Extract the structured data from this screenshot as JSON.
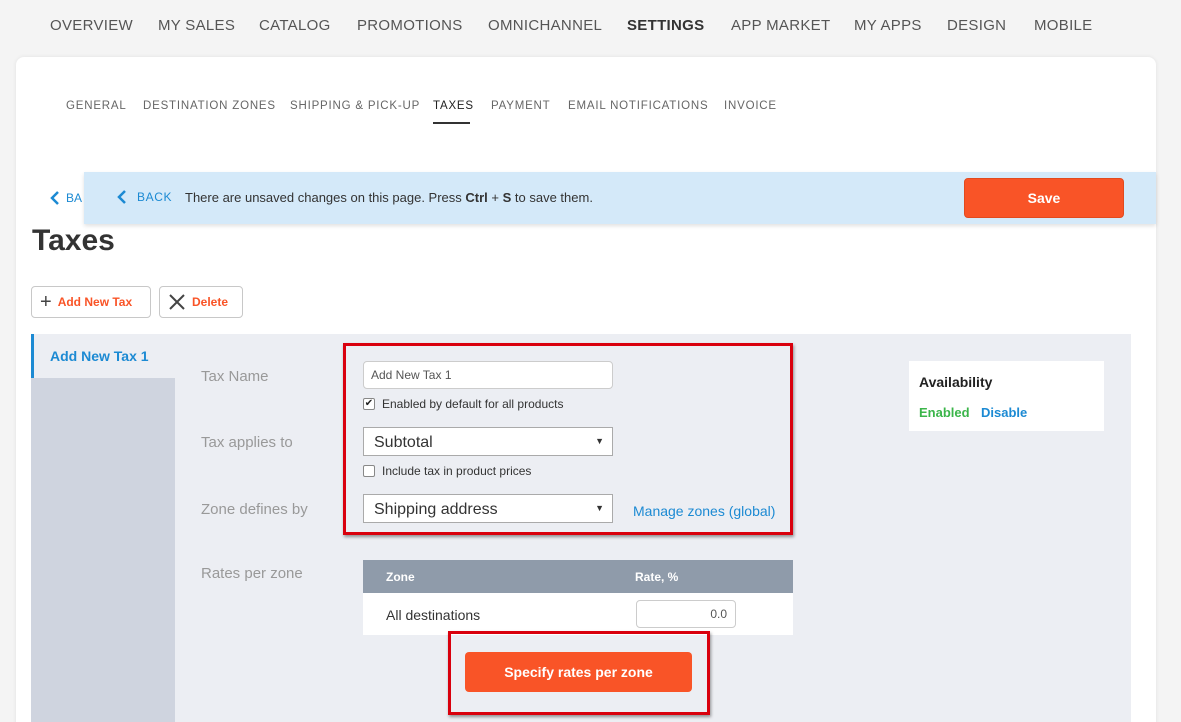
{
  "topnav": {
    "items": [
      "OVERVIEW",
      "MY SALES",
      "CATALOG",
      "PROMOTIONS",
      "OMNICHANNEL",
      "SETTINGS",
      "APP MARKET",
      "MY APPS",
      "DESIGN",
      "MOBILE"
    ],
    "active": "SETTINGS"
  },
  "subtabs": {
    "items": [
      "GENERAL",
      "DESTINATION ZONES",
      "SHIPPING & PICK-UP",
      "TAXES",
      "PAYMENT",
      "EMAIL NOTIFICATIONS",
      "INVOICE"
    ],
    "active": "TAXES"
  },
  "back_under_label": "BA",
  "unsaved_bar": {
    "back_label": "BACK",
    "message_prefix": "There are unsaved changes on this page. Press ",
    "key1": "Ctrl",
    "plus": " + ",
    "key2": "S",
    "message_suffix": " to save them.",
    "save_label": "Save"
  },
  "page_title": "Taxes",
  "actions": {
    "add_label": "Add New Tax",
    "delete_label": "Delete"
  },
  "sidebar": {
    "items": [
      "Add New Tax 1"
    ]
  },
  "form": {
    "tax_name_label": "Tax Name",
    "tax_name_value": "Add New Tax 1",
    "enabled_default_label": "Enabled by default for all products",
    "enabled_default_checked": true,
    "applies_to_label": "Tax applies to",
    "applies_to_value": "Subtotal",
    "include_tax_label": "Include tax in product prices",
    "include_tax_checked": false,
    "zone_defines_label": "Zone defines by",
    "zone_defines_value": "Shipping address",
    "manage_zones_link": "Manage zones (global)",
    "rates_label": "Rates per zone"
  },
  "rates_table": {
    "headers": [
      "Zone",
      "Rate, %"
    ],
    "rows": [
      {
        "zone": "All destinations",
        "rate": "0.0"
      }
    ]
  },
  "specify_rates_label": "Specify rates per zone",
  "availability": {
    "title": "Availability",
    "enabled_label": "Enabled",
    "disable_label": "Disable"
  },
  "colors": {
    "accent_orange": "#f95427",
    "link_blue": "#1c8ad3",
    "enabled_green": "#3bb54a",
    "annotation_red": "#d9000d",
    "unsaved_bar_bg": "#d4e9f9"
  }
}
